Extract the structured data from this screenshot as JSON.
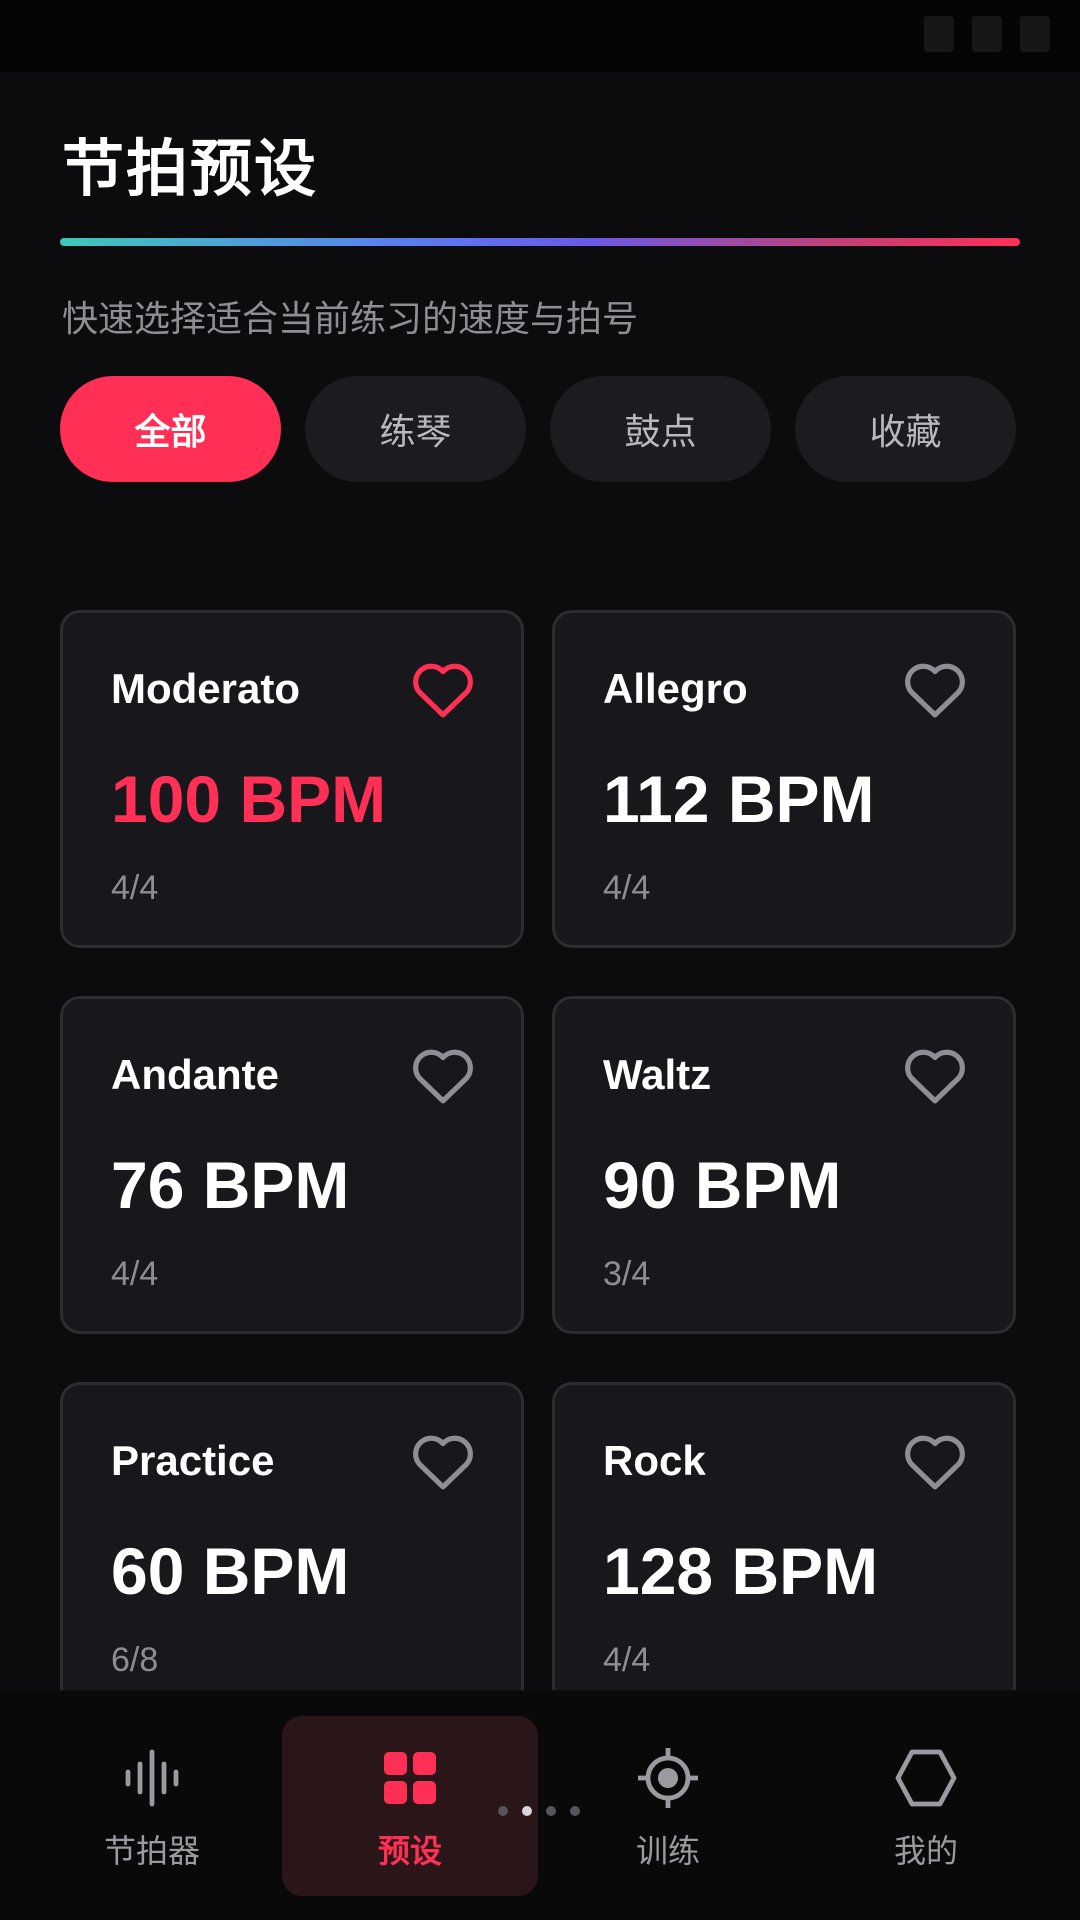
{
  "title": "节拍预设",
  "subtitle": "快速选择适合当前练习的速度与拍号",
  "filters": [
    {
      "label": "全部",
      "active": true
    },
    {
      "label": "练琴",
      "active": false
    },
    {
      "label": "鼓点",
      "active": false
    },
    {
      "label": "收藏",
      "active": false
    }
  ],
  "presets": [
    {
      "name": "Moderato",
      "bpm": "100 BPM",
      "signature": "4/4",
      "favorite": true
    },
    {
      "name": "Allegro",
      "bpm": "112 BPM",
      "signature": "4/4",
      "favorite": false
    },
    {
      "name": "Andante",
      "bpm": "76 BPM",
      "signature": "4/4",
      "favorite": false
    },
    {
      "name": "Waltz",
      "bpm": "90 BPM",
      "signature": "3/4",
      "favorite": false
    },
    {
      "name": "Practice",
      "bpm": "60 BPM",
      "signature": "6/8",
      "favorite": false
    },
    {
      "name": "Rock",
      "bpm": "128 BPM",
      "signature": "4/4",
      "favorite": false
    }
  ],
  "nav": [
    {
      "label": "节拍器",
      "icon": "waveform-icon",
      "active": false
    },
    {
      "label": "预设",
      "icon": "grid-icon",
      "active": true
    },
    {
      "label": "训练",
      "icon": "target-icon",
      "active": false
    },
    {
      "label": "我的",
      "icon": "hexagon-icon",
      "active": false
    }
  ],
  "page_indicator": {
    "count": 4,
    "current": 1
  },
  "colors": {
    "accent": "#ff2f55",
    "background": "#0c0c0e",
    "card": "#18181c",
    "muted": "#8d8d93"
  }
}
